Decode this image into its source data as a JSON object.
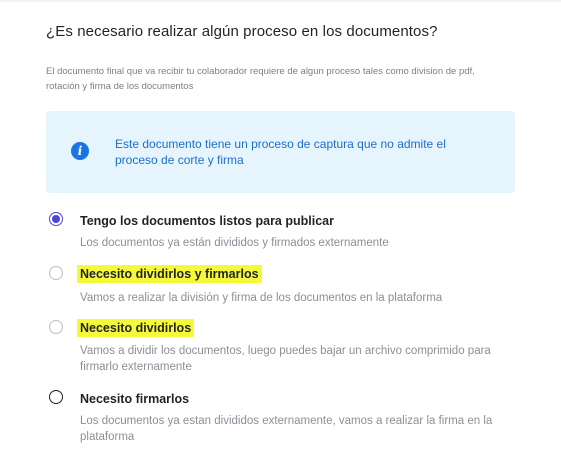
{
  "section": {
    "title": "¿Es necesario realizar algún proceso en los documentos?",
    "description": "El documento final que va recibir tu colaborador requiere de algun proceso tales como division de pdf, rotación y firma de los documentos"
  },
  "info": {
    "icon": "info-icon",
    "text": "Este documento tiene un proceso de captura que no admite el proceso de corte y firma"
  },
  "options": [
    {
      "label": "Tengo los documentos listos para publicar",
      "help": "Los documentos ya están divididos y firmados externamente",
      "selected": true
    },
    {
      "label": "Necesito dividirlos y firmarlos",
      "help": "Vamos a realizar la división y firma de los documentos en la plataforma",
      "selected": false,
      "highlighted": true
    },
    {
      "label": "Necesito dividirlos",
      "help": "Vamos a dividir los documentos, luego puedes bajar un archivo comprimido para firmarlo externamente",
      "selected": false,
      "highlighted": true
    },
    {
      "label": "Necesito firmarlos",
      "help": "Los documentos ya estan divididos externamente, vamos a realizar la firma en la plataforma",
      "selected": false
    }
  ],
  "colors": {
    "accent": "#4c46d9",
    "info_bg": "#e6f4fd",
    "info_text": "#1e6fc9",
    "highlight": "#f6f93a"
  }
}
